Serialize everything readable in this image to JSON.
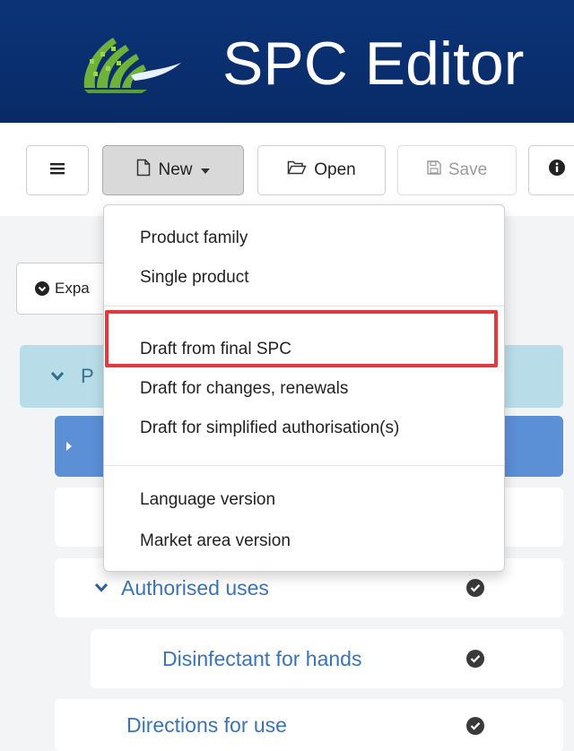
{
  "app": {
    "title": "SPC Editor"
  },
  "toolbar": {
    "new_label": "New",
    "open_label": "Open",
    "save_label": "Save"
  },
  "sidebar": {
    "expand_label": "Expa"
  },
  "tree": {
    "root_label": "P",
    "authorised_uses_label": "Authorised uses",
    "disinfectant_label": "Disinfectant for hands",
    "directions_label": "Directions for use"
  },
  "new_menu": {
    "groups": [
      [
        "Product family",
        "Single product"
      ],
      [
        "Draft from final SPC",
        "Draft for changes, renewals",
        "Draft for simplified authorisation(s)"
      ],
      [
        "Language version",
        "Market area version"
      ]
    ],
    "highlighted_item": "Draft from final SPC"
  },
  "colors": {
    "header_bg": "#0a2d6b",
    "accent_highlight": "#e0393e",
    "selected_row": "#5b8fd6",
    "root_row": "#b8dde9",
    "link_text": "#3a74b8"
  }
}
